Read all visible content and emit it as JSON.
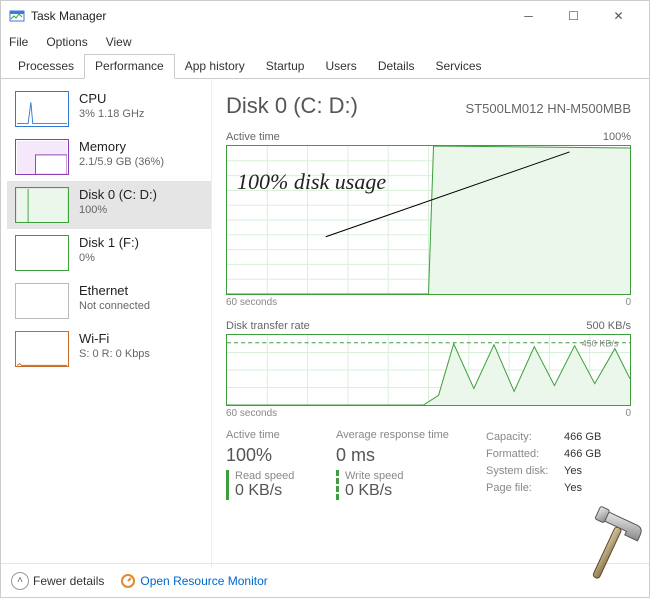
{
  "window": {
    "title": "Task Manager"
  },
  "menu": {
    "file": "File",
    "options": "Options",
    "view": "View"
  },
  "tabs": {
    "processes": "Processes",
    "performance": "Performance",
    "app_history": "App history",
    "startup": "Startup",
    "users": "Users",
    "details": "Details",
    "services": "Services"
  },
  "sidebar": {
    "cpu": {
      "label": "CPU",
      "sub": "3%  1.18 GHz"
    },
    "mem": {
      "label": "Memory",
      "sub": "2.1/5.9 GB (36%)"
    },
    "disk0": {
      "label": "Disk 0 (C: D:)",
      "sub": "100%"
    },
    "disk1": {
      "label": "Disk 1 (F:)",
      "sub": "0%"
    },
    "eth": {
      "label": "Ethernet",
      "sub": "Not connected"
    },
    "wifi": {
      "label": "Wi-Fi",
      "sub": "S: 0 R: 0 Kbps"
    }
  },
  "rp": {
    "title": "Disk 0 (C: D:)",
    "model": "ST500LM012 HN-M500MBB",
    "g1": {
      "label": "Active time",
      "right": "100%",
      "xl": "60 seconds",
      "xr": "0"
    },
    "g2": {
      "label": "Disk transfer rate",
      "right": "500 KB/s",
      "xl": "60 seconds",
      "xr": "0",
      "dash": "450 KB/s"
    }
  },
  "stats": {
    "active_l": "Active time",
    "active_v": "100%",
    "avg_l": "Average response time",
    "avg_v": "0 ms",
    "read_l": "Read speed",
    "read_v": "0 KB/s",
    "write_l": "Write speed",
    "write_v": "0 KB/s"
  },
  "info": {
    "cap_l": "Capacity:",
    "cap_v": "466 GB",
    "fmt_l": "Formatted:",
    "fmt_v": "466 GB",
    "sys_l": "System disk:",
    "sys_v": "Yes",
    "pf_l": "Page file:",
    "pf_v": "Yes"
  },
  "footer": {
    "fewer": "Fewer details",
    "resmon": "Open Resource Monitor"
  },
  "annotation": "100% disk\nusage",
  "colors": {
    "disk": "#3c9f3c"
  },
  "chart_data": [
    {
      "type": "line",
      "title": "Active time",
      "xlabel": "60 seconds → 0",
      "ylabel": "%",
      "ylim": [
        0,
        100
      ],
      "x_seconds_ago": [
        60,
        55,
        50,
        45,
        40,
        35,
        30,
        25,
        20,
        15,
        10,
        5,
        0
      ],
      "values": [
        0,
        0,
        0,
        0,
        0,
        0,
        0,
        100,
        100,
        100,
        100,
        100,
        100
      ]
    },
    {
      "type": "line",
      "title": "Disk transfer rate",
      "xlabel": "60 seconds → 0",
      "ylabel": "KB/s",
      "ylim": [
        0,
        500
      ],
      "dashed_marker": 450,
      "x_seconds_ago": [
        60,
        55,
        50,
        45,
        40,
        35,
        30,
        25,
        20,
        15,
        10,
        5,
        0
      ],
      "values": [
        0,
        0,
        0,
        0,
        0,
        0,
        60,
        440,
        120,
        430,
        100,
        420,
        200
      ]
    }
  ]
}
